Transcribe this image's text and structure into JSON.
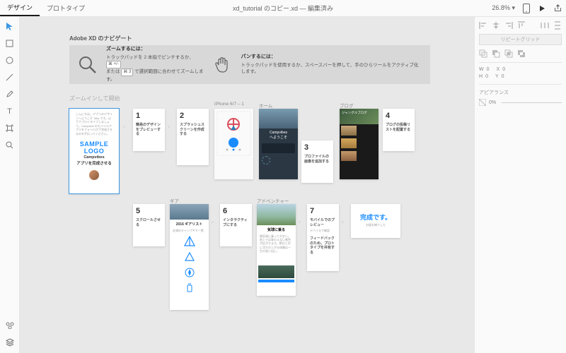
{
  "header": {
    "tabs": {
      "design": "デザイン",
      "prototype": "プロトタイプ"
    },
    "title": "xd_tutorial のコピー.xd — 編集済み",
    "zoom": "26.8%"
  },
  "nav": {
    "title": "Adobe XD のナビゲート",
    "zoom": {
      "h": "ズームするには：",
      "b1": "トラックパッドを 2 本指でピンチするか、",
      "k1": "⌘ +/-",
      "b2": "または",
      "k2": "⌘ 3",
      "b3": "で選択範囲に合わせてズームします。"
    },
    "pan": {
      "h": "パンするには：",
      "b": "トラックパッドを使用するか、スペースバーを押して、手のひらツールをアクティブ化します。"
    }
  },
  "hint": "ズームインして開始",
  "intro": {
    "greet": "こんにちは。アプリのデザインへようこそ Talia です。以下でプロトタイプしましょう。Campvibe のモバイルアプリをフォトログで完成させるのを手伝ってください。",
    "logo": "SAMPLE LOGO",
    "sub1": "Campvibes",
    "sub2": "アプリを完成させる"
  },
  "labels": {
    "phone": "iPhone 6/7 – 1",
    "home": "ホーム",
    "blog": "ブログ",
    "gear": "ギア",
    "adv": "アドベンチャー"
  },
  "steps": {
    "s1": "簡易のデザインをプレビューする",
    "s2": "スプラッシュスクリーンを作成する",
    "s3": "プロファイルの画像を追加する",
    "s4": "ブログの投稿リストを配置する",
    "s5": "スクロールさせる",
    "s6": "インタラクティブにする",
    "s7a": "モバイルでのプレビュー",
    "s7b": "フィードバックのため、プロトタイプを共有する",
    "gearh": "2016 ギアリスト"
  },
  "home": {
    "brand": "Campvibes",
    "wel": "へようこそ"
  },
  "blog": {
    "t": "ジャングルブログ"
  },
  "adv": {
    "t": "気球に乗る"
  },
  "done": "完成です。",
  "rp": {
    "repeat": "リピートグリッド",
    "w": "W",
    "wval": "0",
    "x": "X",
    "xval": "0",
    "h": "H",
    "hval": "0",
    "y": "Y",
    "yval": "0",
    "app": "アピアランス",
    "op": "0%"
  }
}
